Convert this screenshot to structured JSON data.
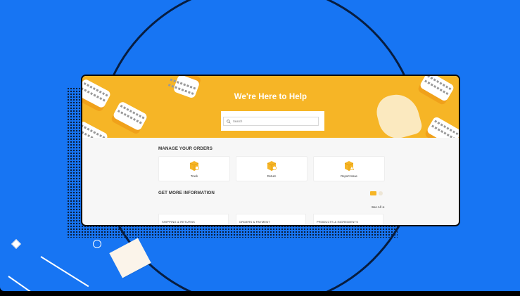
{
  "hero": {
    "title": "We're Here to Help"
  },
  "search": {
    "placeholder": "Search"
  },
  "orders": {
    "heading": "MANAGE YOUR ORDERS",
    "cards": [
      {
        "label": "Track",
        "icon": "box-clock-icon"
      },
      {
        "label": "Return",
        "icon": "box-return-icon"
      },
      {
        "label": "Report Issue",
        "icon": "box-alert-icon"
      }
    ]
  },
  "info": {
    "heading": "GET MORE INFORMATION",
    "see_all": "See All ➔",
    "cards": [
      {
        "label": "SHIPPING & RETURNS"
      },
      {
        "label": "ORDERS & PAYMENT"
      },
      {
        "label": "PRODUCTS & INGREDIENTS"
      }
    ]
  },
  "colors": {
    "background": "#1775f3",
    "hero": "#f6b526",
    "accent": "#f6b526"
  }
}
